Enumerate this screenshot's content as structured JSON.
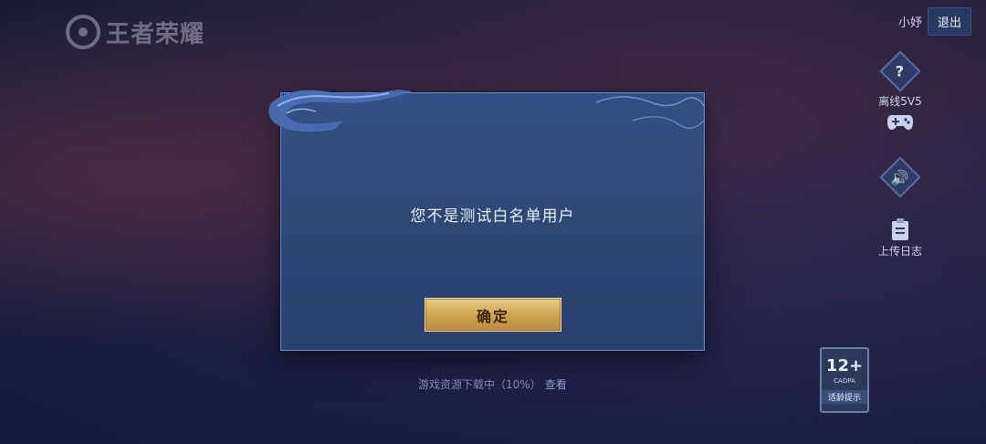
{
  "logo": {
    "text": "王者荣耀"
  },
  "topbar": {
    "username": "小妤",
    "logout_label": "退出"
  },
  "side_menu": [
    {
      "icon": "question-icon",
      "glyph": "?",
      "label": "离线5V5"
    },
    {
      "icon": "gamepad-icon",
      "glyph": "",
      "label": ""
    },
    {
      "icon": "speaker-icon",
      "glyph": "",
      "label": ""
    },
    {
      "icon": "clipboard-icon",
      "glyph": "",
      "label": "上传日志"
    }
  ],
  "age_rating": {
    "number": "12+",
    "org": "CADPA",
    "label": "适龄提示"
  },
  "download": {
    "text": "游戏资源下载中（10%）",
    "view_label": "查看"
  },
  "dialog": {
    "message": "您不是测试白名单用户",
    "confirm_label": "确定"
  },
  "colors": {
    "dialog_bg": "#2f4876",
    "confirm_gold": "#cfa652",
    "accent_border": "#6f8cc4"
  }
}
